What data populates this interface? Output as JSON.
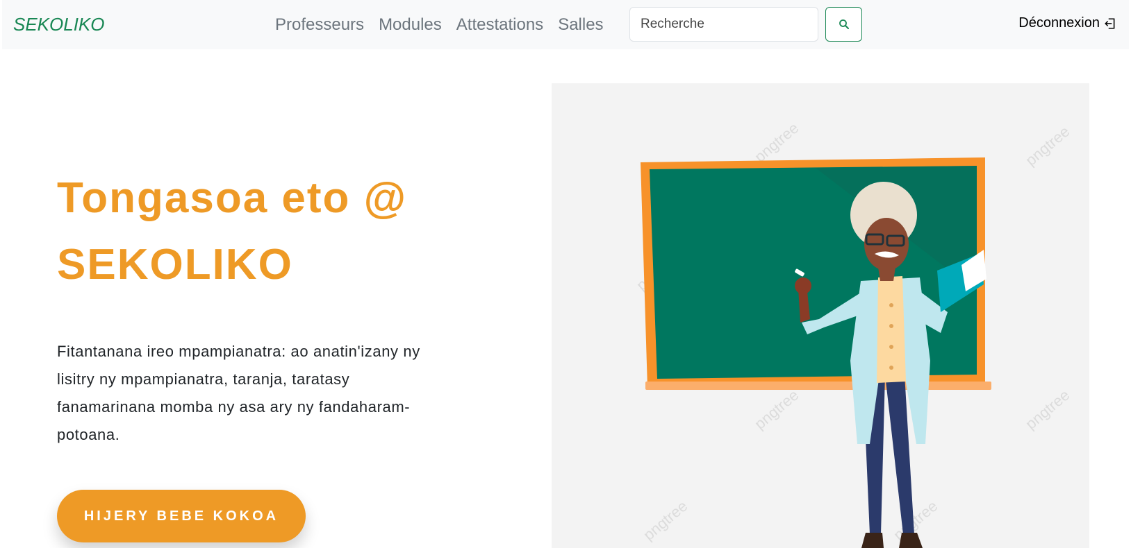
{
  "navbar": {
    "brand": "SEKOLIKO",
    "links": [
      "Professeurs",
      "Modules",
      "Attestations",
      "Salles"
    ],
    "search_placeholder": "Recherche",
    "logout_label": "Déconnexion"
  },
  "hero": {
    "title_line1": "Tongasoa eto @",
    "title_line2": "SEKOLIKO",
    "description": "Fitantanana ireo mpampianatra: ao anatin'izany ny lisitry ny mpampianatra, taranja, taratasy fanamarinana momba ny asa ary ny fandaharam-potoana.",
    "cta_label": "HIJERY BEBE KOKOA"
  },
  "illustration": {
    "watermark": "pngtree"
  },
  "colors": {
    "accent": "#ee9a26",
    "brand_green": "#198754",
    "board_green": "#00775f",
    "board_frame": "#f7922a"
  }
}
